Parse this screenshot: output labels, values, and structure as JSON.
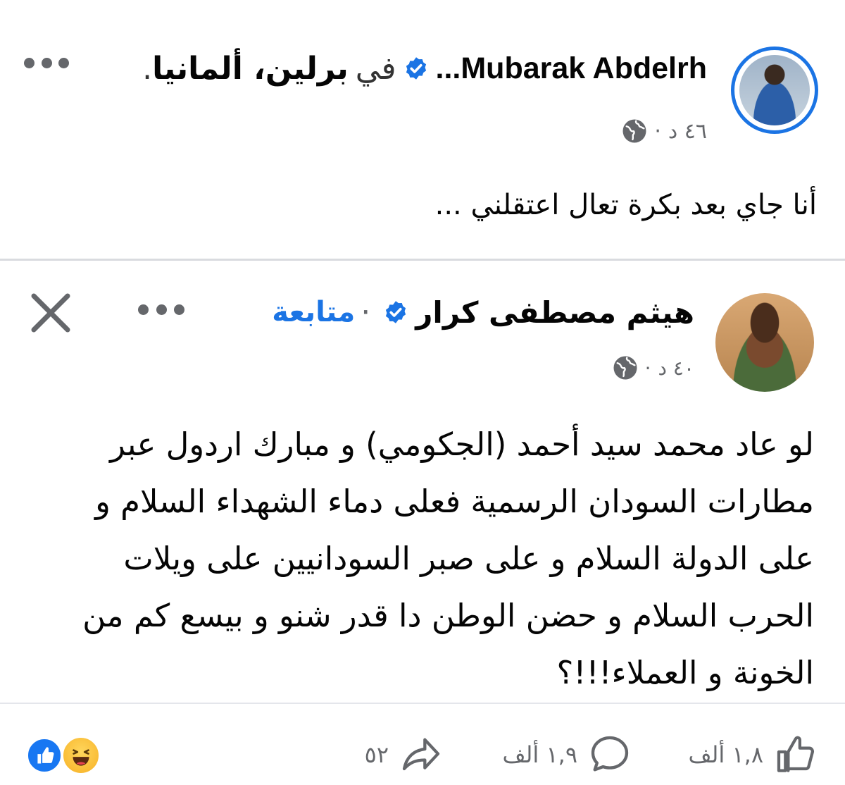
{
  "post": {
    "author": "Mubarak Abdelrh...",
    "location_prefix": "في",
    "location": "برلين، ألمانيا",
    "location_suffix": ".",
    "time": "٤٦ د",
    "separator": "·",
    "text": "أنا جاي بعد بكرة تعال اعتقلني ..."
  },
  "shared_post": {
    "author": "هيثم مصطفى كرار",
    "follow_label": "متابعة",
    "separator": "·",
    "time": "٤٠ د",
    "text": "لو عاد محمد سيد أحمد (الجكومي) و مبارك اردول عبر مطارات السودان الرسمية فعلى دماء الشهداء السلام و على الدولة السلام و على صبر السودانيين على ويلات الحرب السلام و حضن الوطن دا قدر شنو و بيسع كم من الخونة و العملاء!!!؟"
  },
  "footer": {
    "like_count": "١,٨ ألف",
    "comment_count": "١,٩ ألف",
    "share_count": "٥٢"
  },
  "colors": {
    "accent": "#1b74e4",
    "muted": "#65676b"
  },
  "icons": [
    "verified-badge-icon",
    "globe-icon",
    "more-icon",
    "close-icon",
    "like-icon",
    "comment-icon",
    "share-icon",
    "like-reaction-icon",
    "haha-reaction-icon"
  ]
}
